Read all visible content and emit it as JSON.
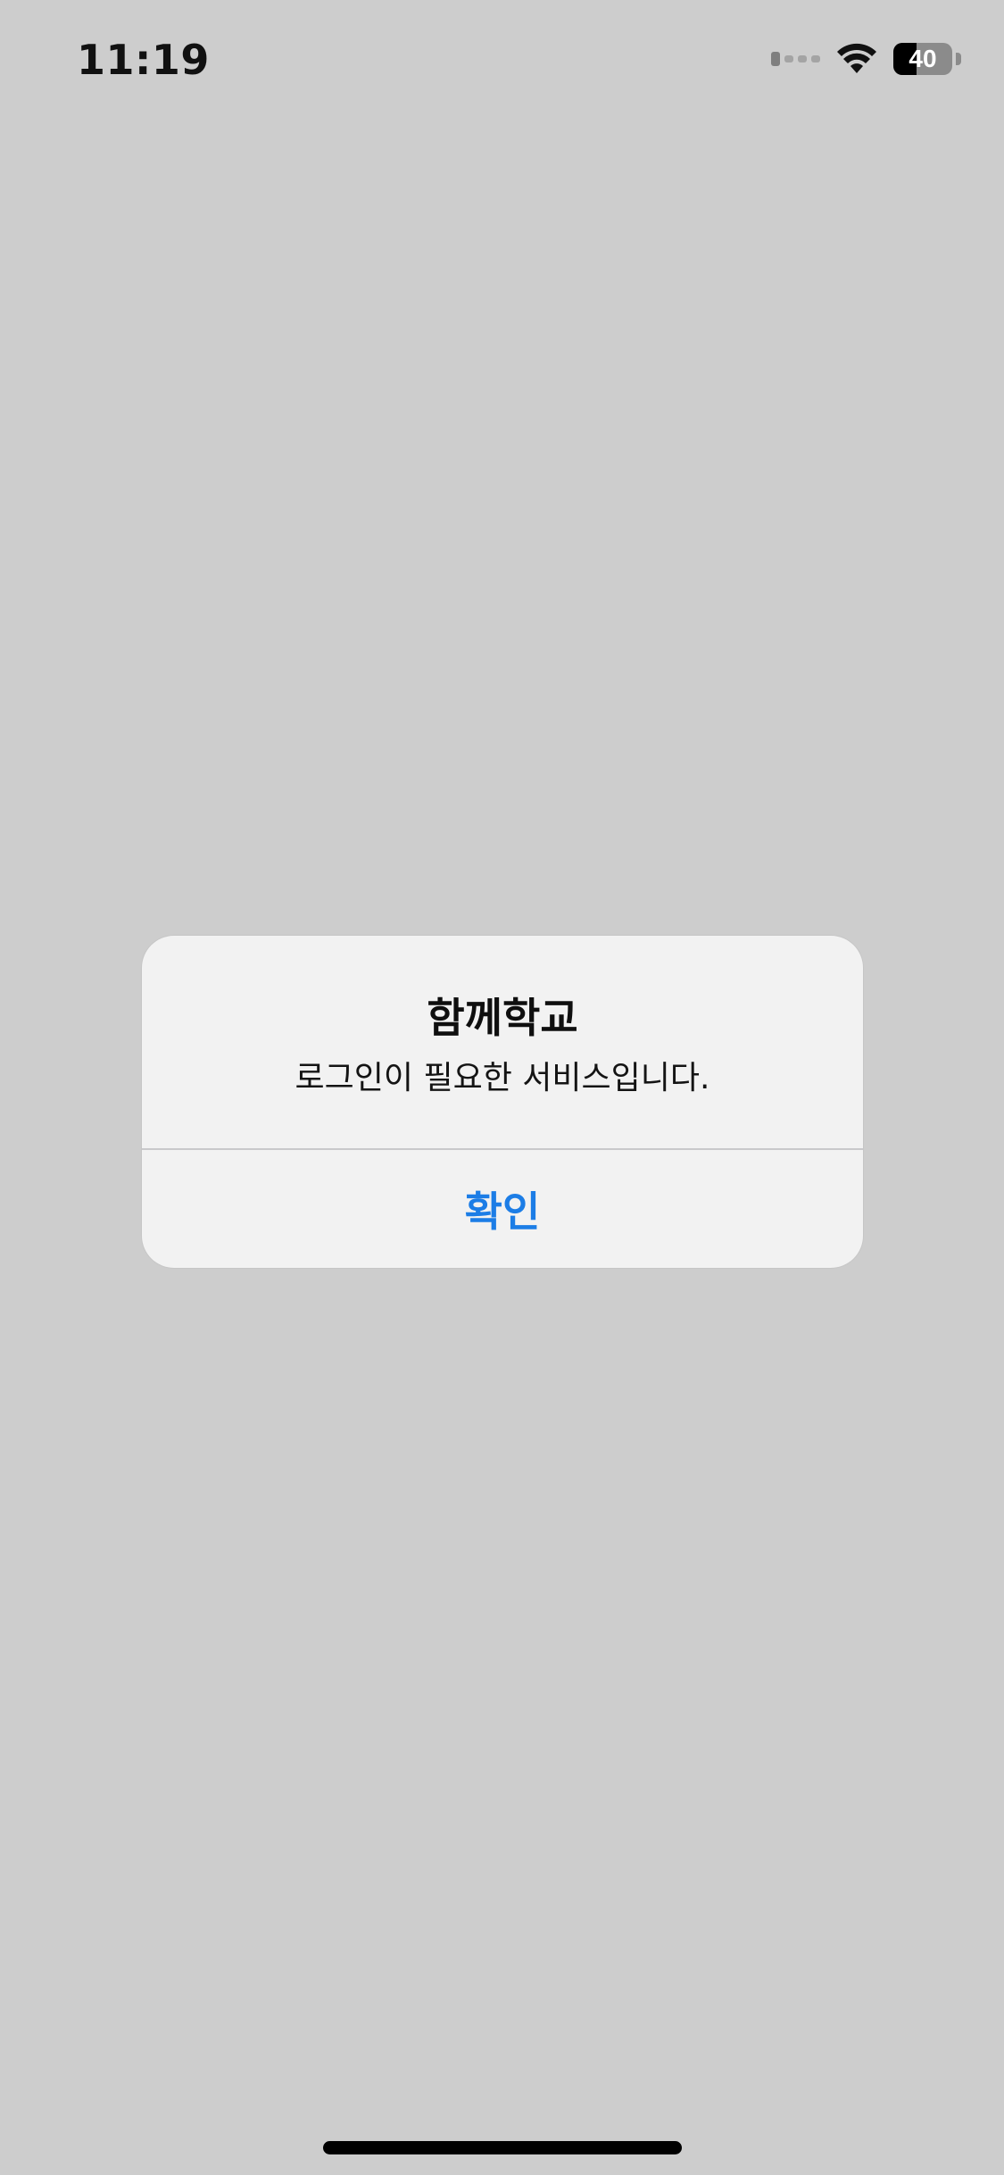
{
  "status_bar": {
    "time": "11:19",
    "signal_icon": "cellular-signal-icon",
    "wifi_icon": "wifi-icon",
    "battery_icon": "battery-icon",
    "battery_percent": "40",
    "battery_level": 0.4
  },
  "alert": {
    "title": "함께학교",
    "message": "로그인이 필요한 서비스입니다.",
    "confirm_label": "확인",
    "accent_color": "#1c7de6"
  },
  "colors": {
    "background": "#cdcdcd",
    "alert_background": "#f2f2f2"
  }
}
